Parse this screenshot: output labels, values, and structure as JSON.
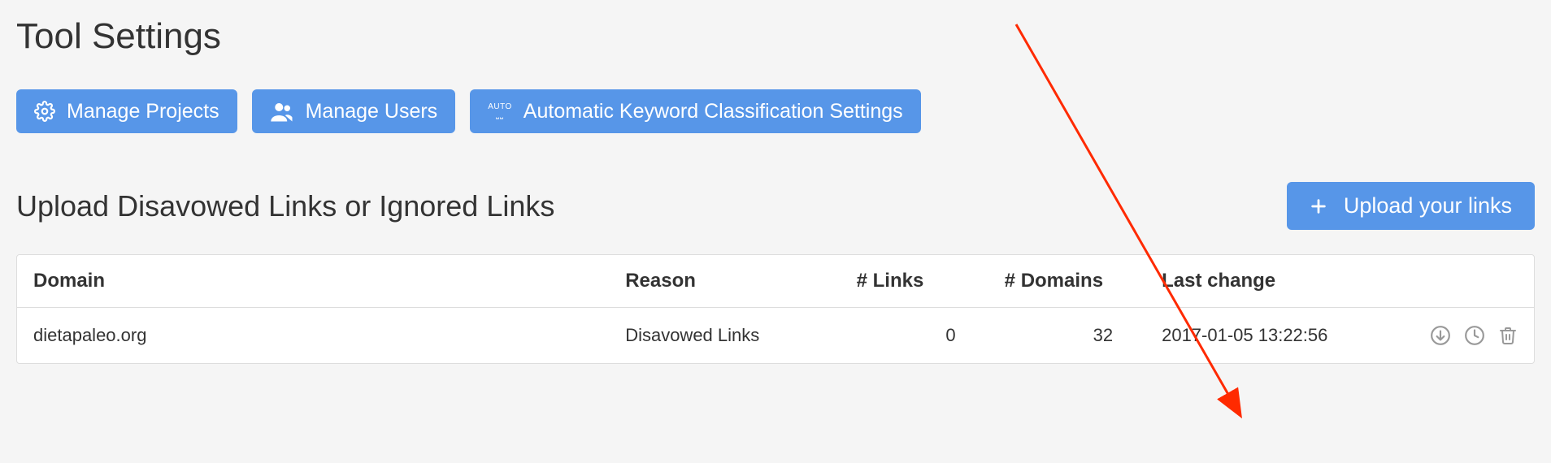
{
  "page": {
    "title": "Tool Settings"
  },
  "buttons": {
    "manage_projects": "Manage Projects",
    "manage_users": "Manage Users",
    "auto_keyword": "Automatic Keyword Classification Settings"
  },
  "section": {
    "title": "Upload Disavowed Links or Ignored Links",
    "upload_btn": "Upload your links"
  },
  "table": {
    "headers": {
      "domain": "Domain",
      "reason": "Reason",
      "links": "# Links",
      "domains": "# Domains",
      "last_change": "Last change"
    },
    "rows": [
      {
        "domain": "dietapaleo.org",
        "reason": "Disavowed Links",
        "links": "0",
        "domains": "32",
        "last_change": "2017-01-05 13:22:56"
      }
    ]
  }
}
